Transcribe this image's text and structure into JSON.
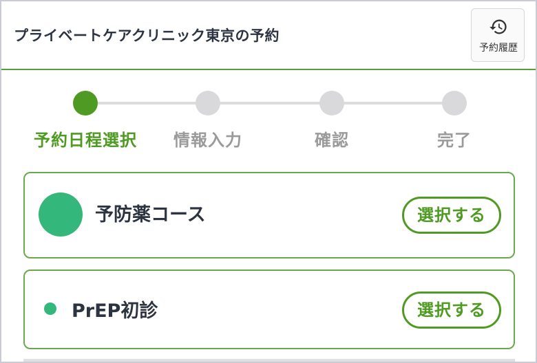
{
  "header": {
    "title": "プライベートケアクリニック東京の予約",
    "history_label": "予約履歴"
  },
  "stepper": {
    "steps": [
      {
        "label": "予約日程選択",
        "active": true
      },
      {
        "label": "情報入力",
        "active": false
      },
      {
        "label": "確認",
        "active": false
      },
      {
        "label": "完了",
        "active": false
      }
    ]
  },
  "courses": [
    {
      "name": "予防薬コース",
      "button": "選択する"
    },
    {
      "name": "PrEP初診",
      "button": "選択する"
    }
  ],
  "colors": {
    "accent": "#4f9a22",
    "course_dot": "#34b77a",
    "inactive_step": "#d9d9dc"
  },
  "icons": {
    "history": "history-icon"
  }
}
